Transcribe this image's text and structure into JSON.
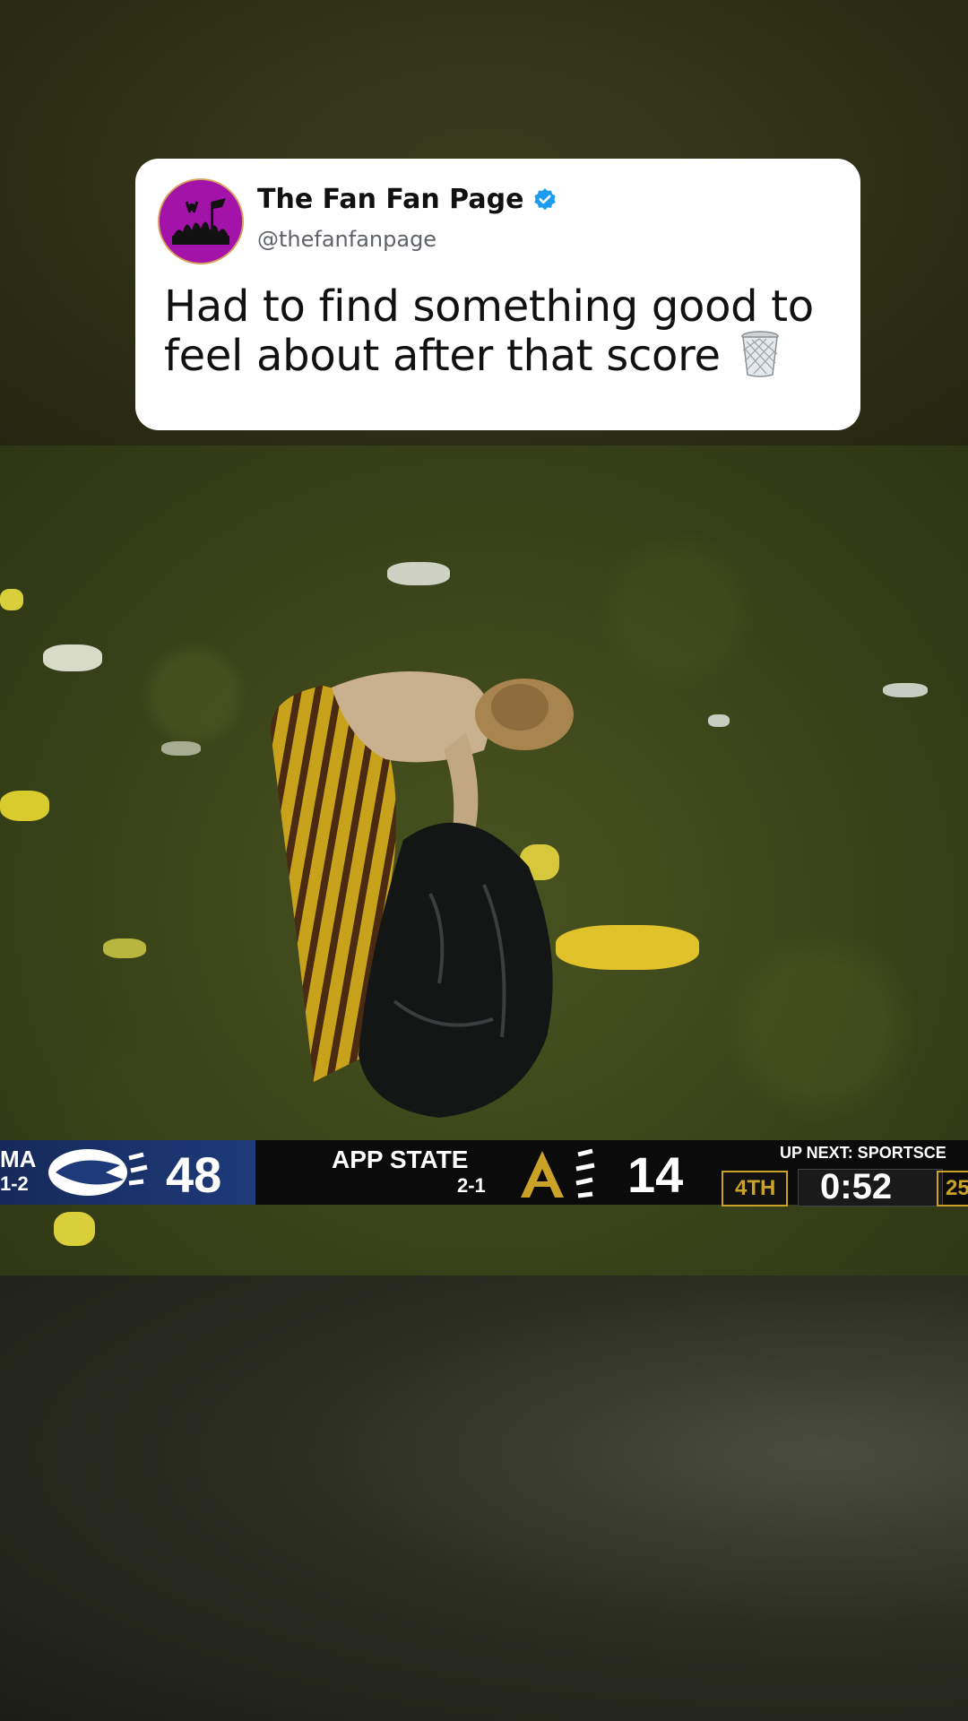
{
  "tweet": {
    "display_name": "The Fan Fan Page",
    "handle": "@thefanfanpage",
    "text": "Had to find something good to feel about after that score",
    "emoji_icon": "wastebasket-icon",
    "verified_icon": "verified-badge-icon",
    "avatar_color": "#a312a9"
  },
  "scoreboard": {
    "home_abbrev": "MA",
    "home_record": "1-2",
    "home_score": "48",
    "away_name": "APP STATE",
    "away_record": "2-1",
    "away_score": "14",
    "up_next": "UP NEXT: SPORTSCE",
    "quarter": "4TH",
    "clock": "0:52",
    "extra": "25",
    "home_color": "#1e3a7a",
    "accent_color": "#c9a227"
  }
}
